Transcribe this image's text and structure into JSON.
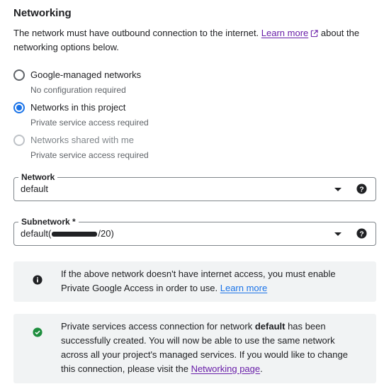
{
  "section": {
    "title": "Networking"
  },
  "intro": {
    "text_before": "The network must have outbound connection to the internet. ",
    "link": "Learn more",
    "text_after": " about the networking options below."
  },
  "radio_options": [
    {
      "label": "Google-managed networks",
      "description": "No configuration required",
      "selected": false,
      "disabled": false
    },
    {
      "label": "Networks in this project",
      "description": "Private service access required",
      "selected": true,
      "disabled": false
    },
    {
      "label": "Networks shared with me",
      "description": "Private service access required",
      "selected": false,
      "disabled": true
    }
  ],
  "network_field": {
    "label": "Network",
    "value": "default"
  },
  "subnetwork_field": {
    "label": "Subnetwork *",
    "value_prefix": "default(",
    "value_suffix": "/20)"
  },
  "info_callout": {
    "text": "If the above network doesn't have internet access, you must enable Private Google Access in order to use. ",
    "link": "Learn more"
  },
  "success_callout": {
    "text_before": "Private services access connection for network ",
    "network_name": "default",
    "text_after": " has been successfully created. You will now be able to use the same network across all your project's managed services. If you would like to change this connection, please visit the ",
    "link": "Networking page",
    "text_end": "."
  },
  "colors": {
    "accent": "#1a73e8",
    "visited_link": "#681da8",
    "success": "#1e8e3e",
    "callout_bg": "#f1f3f4"
  },
  "icons": [
    "external-link-icon",
    "dropdown-caret-icon",
    "help-icon",
    "info-icon",
    "check-circle-icon"
  ]
}
